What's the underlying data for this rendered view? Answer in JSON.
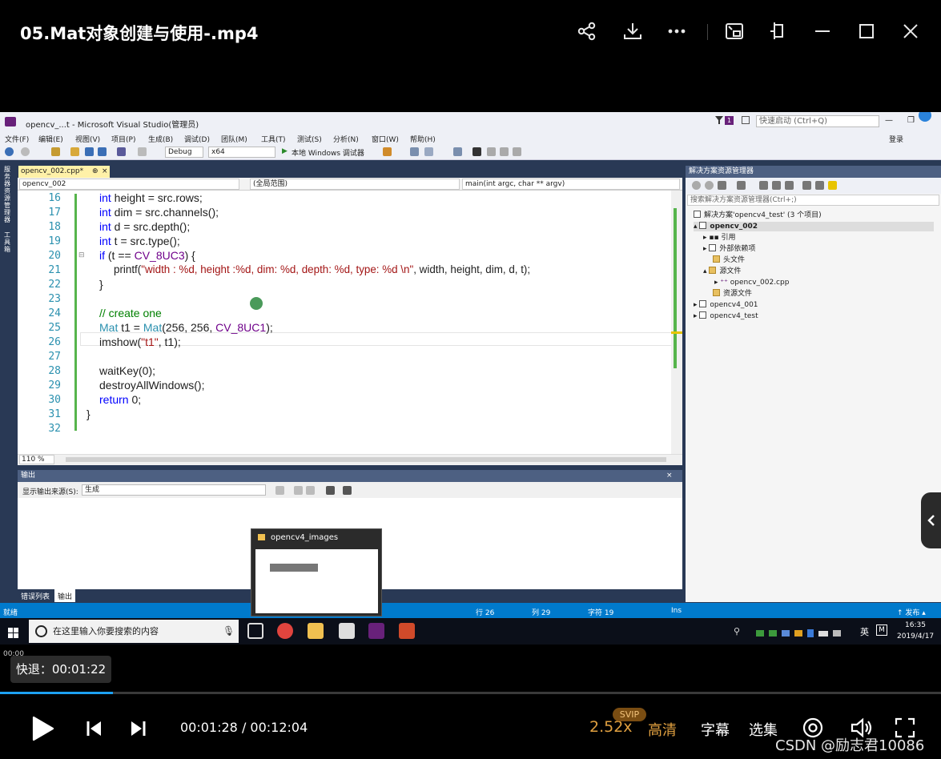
{
  "player": {
    "title": "05.Mat对象创建与使用-.mp4",
    "seek_tip": "快退：00:01:22",
    "time_start": "00:00",
    "current_time": "00:01:28",
    "total_time": "00:12:04",
    "timecode": "00:01:28 / 00:12:04",
    "progress": 0.12,
    "speed": "2.52x",
    "svip_badge": "SVIP",
    "quality": "高清",
    "subtitle": "字幕",
    "episodes": "选集",
    "watermark": "CSDN @励志君10086",
    "accent_color": "#e0a040",
    "icons": [
      "share-icon",
      "download-icon",
      "more-icon",
      "pip-icon",
      "pin-icon",
      "minimize-icon",
      "maximize-icon",
      "close-icon",
      "play-icon",
      "previous-icon",
      "next-icon",
      "danmaku-icon",
      "volume-icon",
      "fullscreen-icon"
    ]
  },
  "vs": {
    "window_title": "opencv_...t - Microsoft Visual Studio(管理员)",
    "quick_launch": "快速启动 (Ctrl+Q)",
    "notification_count": "1",
    "login": "登录",
    "menu": [
      "文件(F)",
      "编辑(E)",
      "视图(V)",
      "项目(P)",
      "生成(B)",
      "调试(D)",
      "团队(M)",
      "工具(T)",
      "测试(S)",
      "分析(N)",
      "窗口(W)",
      "帮助(H)"
    ],
    "toolbar": {
      "config": "Debug",
      "platform": "x64",
      "debugger": "本地 Windows 调试器"
    },
    "left_tabs": [
      "服务器资源管理器",
      "工具箱"
    ],
    "doc_tab": "opencv_002.cpp*",
    "nav": {
      "project": "opencv_002",
      "scope": "(全局范围)",
      "function": "main(int argc, char ** argv)"
    },
    "code_lines": [
      {
        "num": "16",
        "text": "int height = src.rows;"
      },
      {
        "num": "17",
        "text": "int dim = src.channels();"
      },
      {
        "num": "18",
        "text": "int d = src.depth();"
      },
      {
        "num": "19",
        "text": "int t = src.type();"
      },
      {
        "num": "20",
        "text": "if (t == CV_8UC3) {"
      },
      {
        "num": "21",
        "text": "printf(\"width : %d, height :%d, dim: %d, depth: %d, type: %d \\n\", width, height, dim, d, t);"
      },
      {
        "num": "22",
        "text": "}"
      },
      {
        "num": "23",
        "text": ""
      },
      {
        "num": "24",
        "text": "// create one"
      },
      {
        "num": "25",
        "text": "Mat t1 = Mat(256, 256, CV_8UC1);"
      },
      {
        "num": "26",
        "text": "imshow(\"t1\", t1);"
      },
      {
        "num": "27",
        "text": ""
      },
      {
        "num": "28",
        "text": "waitKey(0);"
      },
      {
        "num": "29",
        "text": "destroyAllWindows();"
      },
      {
        "num": "30",
        "text": "return 0;"
      },
      {
        "num": "31",
        "text": "}"
      },
      {
        "num": "32",
        "text": ""
      }
    ],
    "zoom": "110 %",
    "output": {
      "title": "输出",
      "source_label": "显示输出来源(S):",
      "source_value": "生成",
      "tabs": [
        "错误列表",
        "输出"
      ]
    },
    "solution": {
      "title": "解决方案资源管理器",
      "search_placeholder": "搜索解决方案资源管理器(Ctrl+;)",
      "items": [
        "解决方案'opencv4_test' (3 个项目)",
        "opencv_002",
        "引用",
        "外部依赖项",
        "头文件",
        "源文件",
        "opencv_002.cpp",
        "资源文件",
        "opencv4_001",
        "opencv4_test"
      ]
    },
    "status": {
      "ready": "就绪",
      "row": "行 26",
      "col": "列 29",
      "char": "字符 19",
      "ins": "Ins",
      "publish": "↑ 发布 ▴"
    },
    "taskbar": {
      "search_placeholder": "在这里输入你要搜索的内容",
      "thumb_title": "opencv4_images",
      "time": "16:35",
      "date": "2019/4/17",
      "ime": "英"
    }
  }
}
